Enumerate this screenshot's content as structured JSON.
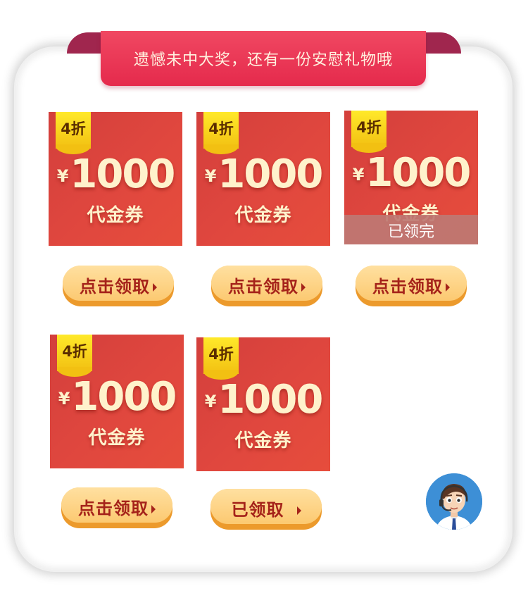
{
  "banner": {
    "title": "遗憾未中大奖，还有一份安慰礼物哦"
  },
  "coupons": [
    {
      "discount": "4折",
      "currency": "¥",
      "amount": "1000",
      "label": "代金券",
      "sold_out": false,
      "button_label": "点击领取"
    },
    {
      "discount": "4折",
      "currency": "¥",
      "amount": "1000",
      "label": "代金券",
      "sold_out": false,
      "button_label": "点击领取"
    },
    {
      "discount": "4折",
      "currency": "¥",
      "amount": "1000",
      "label": "代金券",
      "sold_out": true,
      "sold_out_text": "已领完",
      "button_label": "点击领取"
    },
    {
      "discount": "4折",
      "currency": "¥",
      "amount": "1000",
      "label": "代金券",
      "sold_out": false,
      "button_label": "点击领取"
    },
    {
      "discount": "4折",
      "currency": "¥",
      "amount": "1000",
      "label": "代金券",
      "sold_out": false,
      "button_label": "已领取"
    }
  ],
  "support": {
    "icon": "customer-service-avatar-icon"
  },
  "colors": {
    "banner": "#e52a4c",
    "coupon": "#e0473e",
    "tag": "#f2c012",
    "button": "#fcc971",
    "button_text": "#a5231a"
  }
}
